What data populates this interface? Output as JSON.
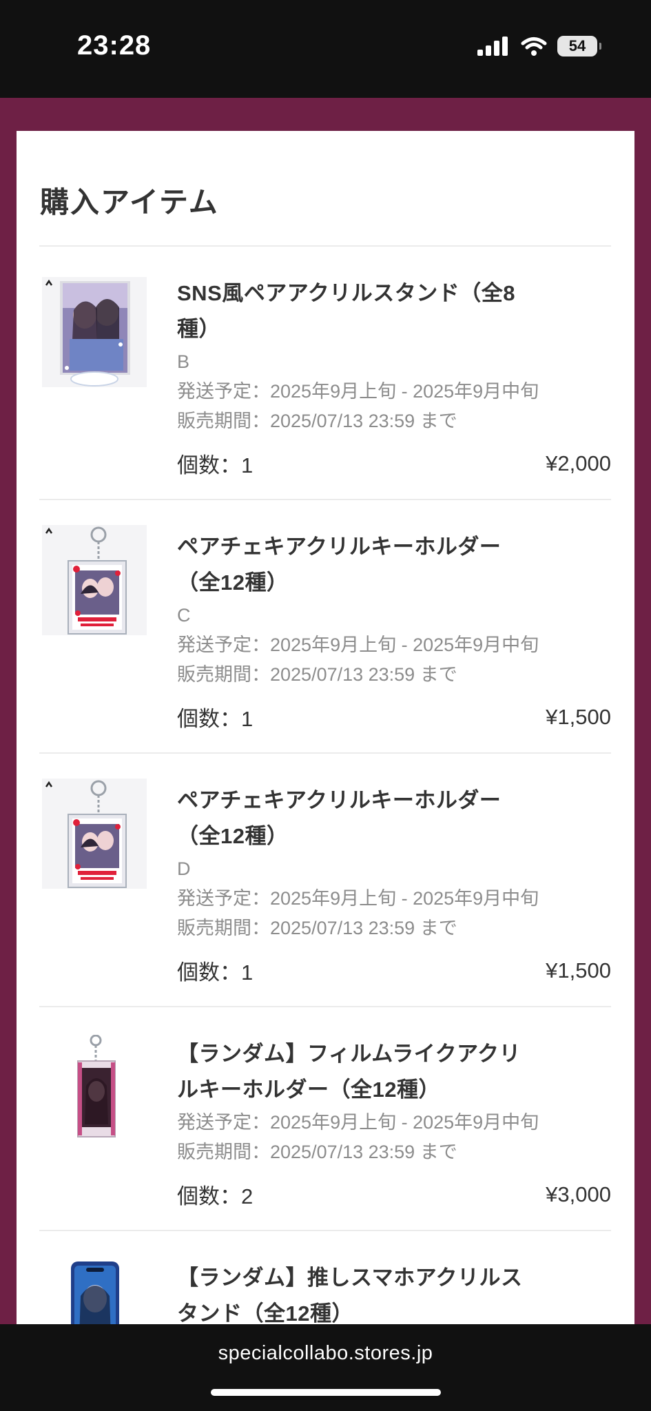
{
  "status_bar": {
    "time": "23:28",
    "battery_level": "54"
  },
  "section_title": "購入アイテム",
  "items": [
    {
      "name_line1": "SNS風ペアアクリルスタンド（全8",
      "name_line2": "種）",
      "variant": "B",
      "shipping": "発送予定：2025年9月上旬 - 2025年9月中旬",
      "sales_period": "販売期間：2025/07/13 23:59 まで",
      "quantity": "個数：1",
      "price": "¥2,000",
      "thumbnail_icon": "acrylic-stand-photo"
    },
    {
      "name_line1": "ペアチェキアクリルキーホルダー",
      "name_line2": "（全12種）",
      "variant": "C",
      "shipping": "発送予定：2025年9月上旬 - 2025年9月中旬",
      "sales_period": "販売期間：2025/07/13 23:59 まで",
      "quantity": "個数：1",
      "price": "¥1,500",
      "thumbnail_icon": "acrylic-keychain-photo"
    },
    {
      "name_line1": "ペアチェキアクリルキーホルダー",
      "name_line2": "（全12種）",
      "variant": "D",
      "shipping": "発送予定：2025年9月上旬 - 2025年9月中旬",
      "sales_period": "販売期間：2025/07/13 23:59 まで",
      "quantity": "個数：1",
      "price": "¥1,500",
      "thumbnail_icon": "acrylic-keychain-photo"
    },
    {
      "name_line1": "【ランダム】フィルムライクアクリ",
      "name_line2": "ルキーホルダー（全12種）",
      "shipping": "発送予定：2025年9月上旬 - 2025年9月中旬",
      "sales_period": "販売期間：2025/07/13 23:59 まで",
      "quantity": "個数：2",
      "price": "¥3,000",
      "thumbnail_icon": "film-keychain-photo"
    },
    {
      "name_line1": "【ランダム】推しスマホアクリルス",
      "name_line2": "タンド（全12種）",
      "thumbnail_icon": "phone-stand-photo"
    }
  ],
  "browser": {
    "url": "specialcollabo.stores.jp"
  },
  "colors": {
    "brand_background": "#6e2045",
    "card_background": "#ffffff",
    "text_primary": "#333333",
    "text_secondary": "#8c8c8c",
    "divider": "#ebebeb",
    "system_bar": "#111111"
  }
}
